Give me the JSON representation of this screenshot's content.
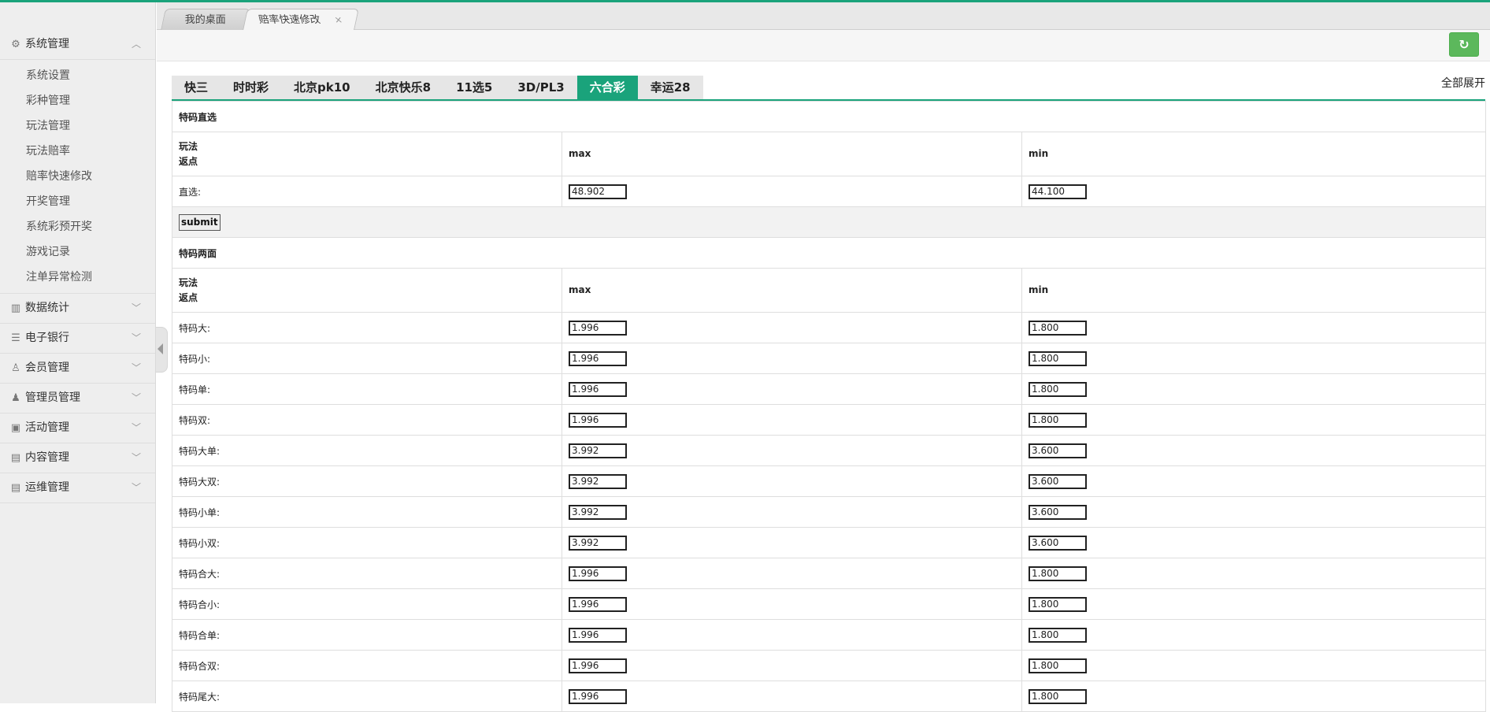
{
  "sidebar": {
    "groups": [
      {
        "label": "系统管理",
        "icon": "gear-icon"
      },
      {
        "label": "数据统计",
        "icon": "bar-chart-icon"
      },
      {
        "label": "电子银行",
        "icon": "list-icon"
      },
      {
        "label": "会员管理",
        "icon": "user-icon"
      },
      {
        "label": "管理员管理",
        "icon": "admin-icon"
      },
      {
        "label": "活动管理",
        "icon": "gift-icon"
      },
      {
        "label": "内容管理",
        "icon": "document-icon"
      },
      {
        "label": "运维管理",
        "icon": "server-icon"
      }
    ],
    "system_items": [
      "系统设置",
      "彩种管理",
      "玩法管理",
      "玩法赔率",
      "赔率快速修改",
      "开奖管理",
      "系统彩预开奖",
      "游戏记录",
      "注单异常检测"
    ]
  },
  "page_tabs": [
    {
      "label": "我的桌面"
    },
    {
      "label": "赔率快速修改",
      "close": "×"
    }
  ],
  "toolbar": {
    "refresh_icon": "refresh-icon",
    "refresh_glyph": "↻"
  },
  "lottery_tabs": {
    "items": [
      "快三",
      "时时彩",
      "北京pk10",
      "北京快乐8",
      "11选5",
      "3D/PL3",
      "六合彩",
      "幸运28"
    ],
    "active": "六合彩",
    "expand_all": "全部展开"
  },
  "columns": {
    "play": "玩法",
    "rebate": "返点",
    "max": "max",
    "min": "min"
  },
  "sections": [
    {
      "title": "特码直选",
      "rows": [
        {
          "label": "直选:",
          "max": "48.902",
          "min": "44.100"
        }
      ],
      "submit": "submit"
    },
    {
      "title": "特码两面",
      "rows": [
        {
          "label": "特码大:",
          "max": "1.996",
          "min": "1.800"
        },
        {
          "label": "特码小:",
          "max": "1.996",
          "min": "1.800"
        },
        {
          "label": "特码单:",
          "max": "1.996",
          "min": "1.800"
        },
        {
          "label": "特码双:",
          "max": "1.996",
          "min": "1.800"
        },
        {
          "label": "特码大单:",
          "max": "3.992",
          "min": "3.600"
        },
        {
          "label": "特码大双:",
          "max": "3.992",
          "min": "3.600"
        },
        {
          "label": "特码小单:",
          "max": "3.992",
          "min": "3.600"
        },
        {
          "label": "特码小双:",
          "max": "3.992",
          "min": "3.600"
        },
        {
          "label": "特码合大:",
          "max": "1.996",
          "min": "1.800"
        },
        {
          "label": "特码合小:",
          "max": "1.996",
          "min": "1.800"
        },
        {
          "label": "特码合单:",
          "max": "1.996",
          "min": "1.800"
        },
        {
          "label": "特码合双:",
          "max": "1.996",
          "min": "1.800"
        },
        {
          "label": "特码尾大:",
          "max": "1.996",
          "min": "1.800"
        }
      ]
    }
  ],
  "colors": {
    "accent": "#1aa37b",
    "refresh": "#5cb85c"
  }
}
